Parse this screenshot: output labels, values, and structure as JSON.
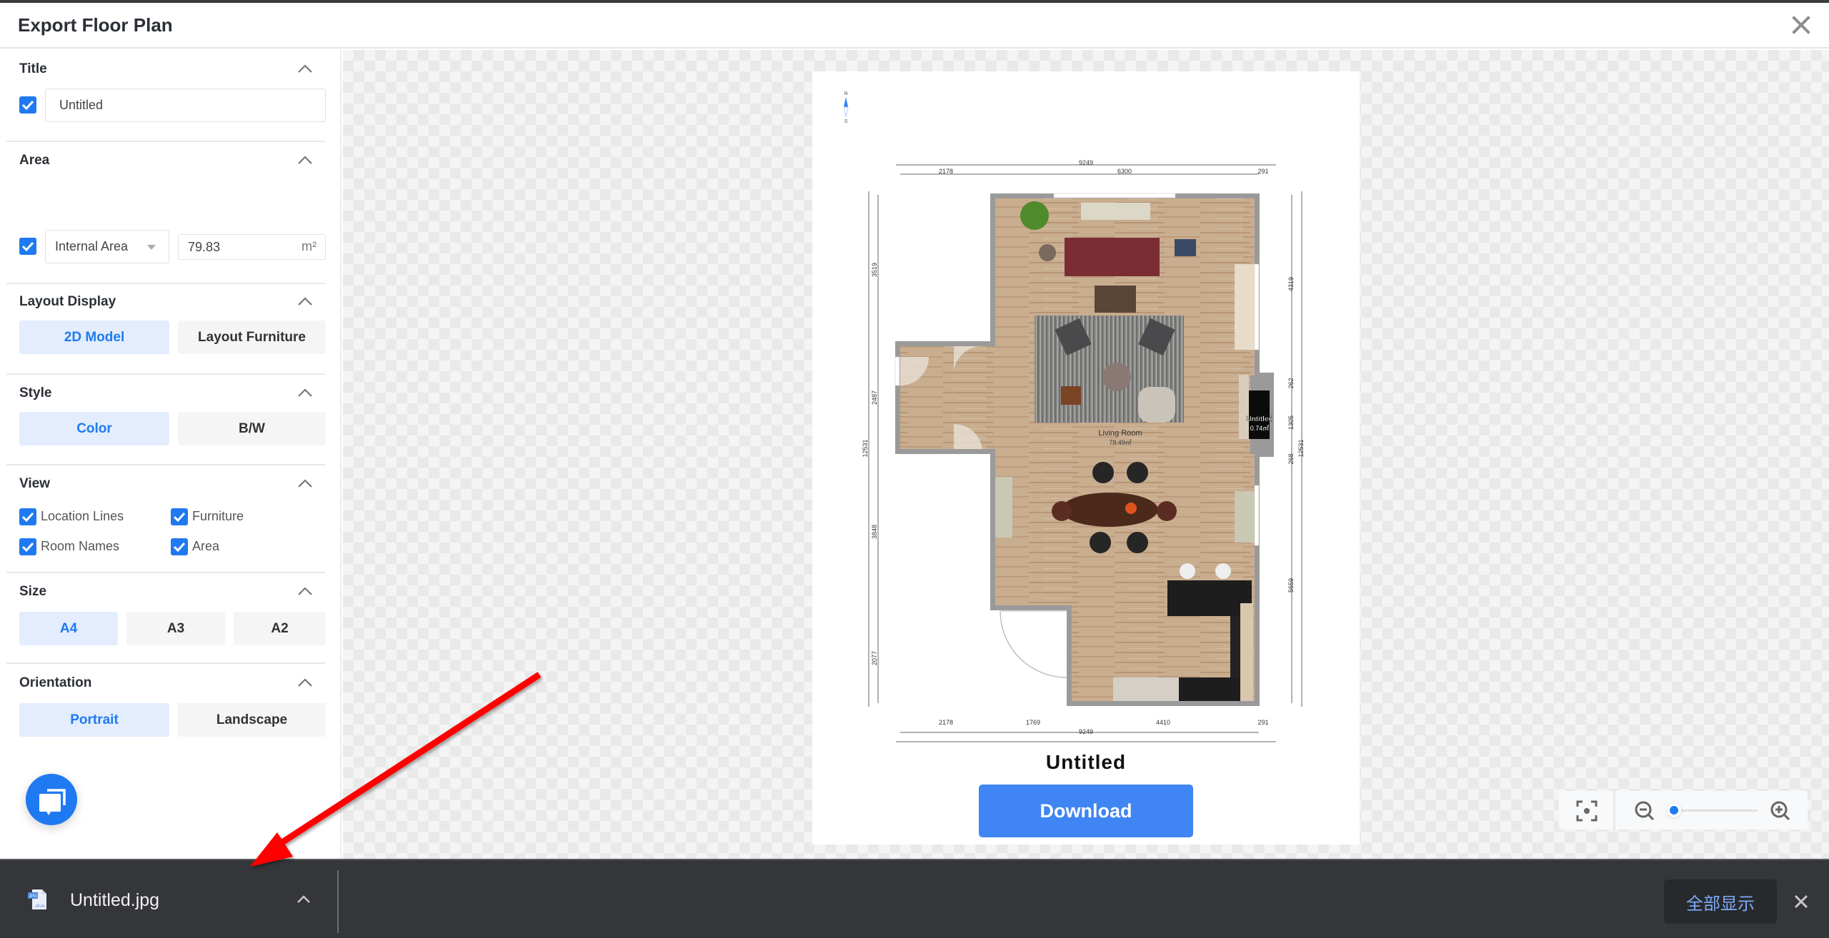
{
  "header": {
    "title": "Export Floor Plan"
  },
  "sidebar": {
    "title_section": {
      "label": "Title",
      "enabled": true,
      "value": "Untitled"
    },
    "area_section": {
      "label": "Area",
      "enabled": true,
      "type": "Internal Area",
      "value": "79.83",
      "unit": "m²"
    },
    "layout_display": {
      "label": "Layout Display",
      "options": [
        "2D Model",
        "Layout Furniture"
      ],
      "selected": "2D Model"
    },
    "style": {
      "label": "Style",
      "options": [
        "Color",
        "B/W"
      ],
      "selected": "Color"
    },
    "view": {
      "label": "View",
      "items": [
        {
          "label": "Location Lines",
          "checked": true
        },
        {
          "label": "Furniture",
          "checked": true
        },
        {
          "label": "Room Names",
          "checked": true
        },
        {
          "label": "Area",
          "checked": true
        }
      ]
    },
    "size": {
      "label": "Size",
      "options": [
        "A4",
        "A3",
        "A2"
      ],
      "selected": "A4"
    },
    "orientation": {
      "label": "Orientation",
      "options": [
        "Portrait",
        "Landscape"
      ],
      "selected": "Portrait"
    }
  },
  "preview": {
    "compass": {
      "north": "N",
      "south": "S"
    },
    "dimensions": {
      "top_total": "9249",
      "top_segments": [
        "2178",
        "6300",
        "291"
      ],
      "bottom_total": "9249",
      "bottom_segments": [
        "2178",
        "1769",
        "4410",
        "291"
      ],
      "left_total": "12531",
      "left_segments": [
        "3519",
        "2487",
        "3848",
        "2077"
      ],
      "right_total": "12531",
      "right_segments": [
        "4319",
        "262",
        "1305",
        "268",
        "5659"
      ]
    },
    "rooms": [
      {
        "name": "Living Room",
        "area": "78.49㎡"
      },
      {
        "name": "Untitled",
        "area": "0.74㎡"
      }
    ],
    "plan_title": "Untitled",
    "download_label": "Download",
    "zoom_level": 0.0
  },
  "download_bar": {
    "file_name": "Untitled.jpg",
    "file_icon": "jpg-file-icon",
    "show_all_label": "全部显示"
  },
  "colors": {
    "accent": "#1f7af1",
    "download_button": "#3f85f3",
    "selected_bg": "#e3edfd",
    "annotation_arrow": "#ff0000"
  }
}
